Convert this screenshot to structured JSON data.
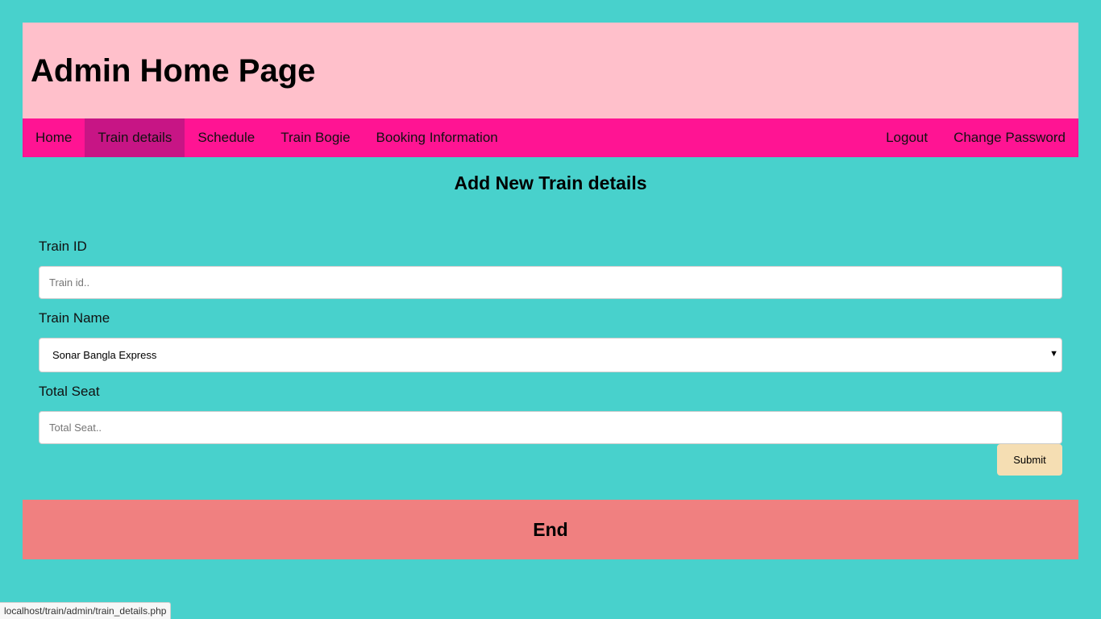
{
  "header": {
    "title": "Admin Home Page"
  },
  "nav": {
    "left": [
      {
        "label": "Home",
        "active": false
      },
      {
        "label": "Train details",
        "active": true
      },
      {
        "label": "Schedule",
        "active": false
      },
      {
        "label": "Train Bogie",
        "active": false
      },
      {
        "label": "Booking Information",
        "active": false
      }
    ],
    "right": [
      {
        "label": "Logout"
      },
      {
        "label": "Change Password"
      }
    ]
  },
  "form": {
    "heading": "Add New Train details",
    "train_id": {
      "label": "Train ID",
      "placeholder": "Train id..",
      "value": ""
    },
    "train_name": {
      "label": "Train Name",
      "selected": "Sonar Bangla Express"
    },
    "total_seat": {
      "label": "Total Seat",
      "placeholder": "Total Seat..",
      "value": ""
    },
    "submit_label": "Submit"
  },
  "footer": {
    "text": "End"
  },
  "statusbar": {
    "url": "localhost/train/admin/train_details.php"
  },
  "colors": {
    "background": "#48d1cc",
    "header": "#ffc0cb",
    "navbar": "#ff1493",
    "nav_active": "#c71585",
    "submit": "#f5deb3",
    "footer": "#f08080"
  }
}
